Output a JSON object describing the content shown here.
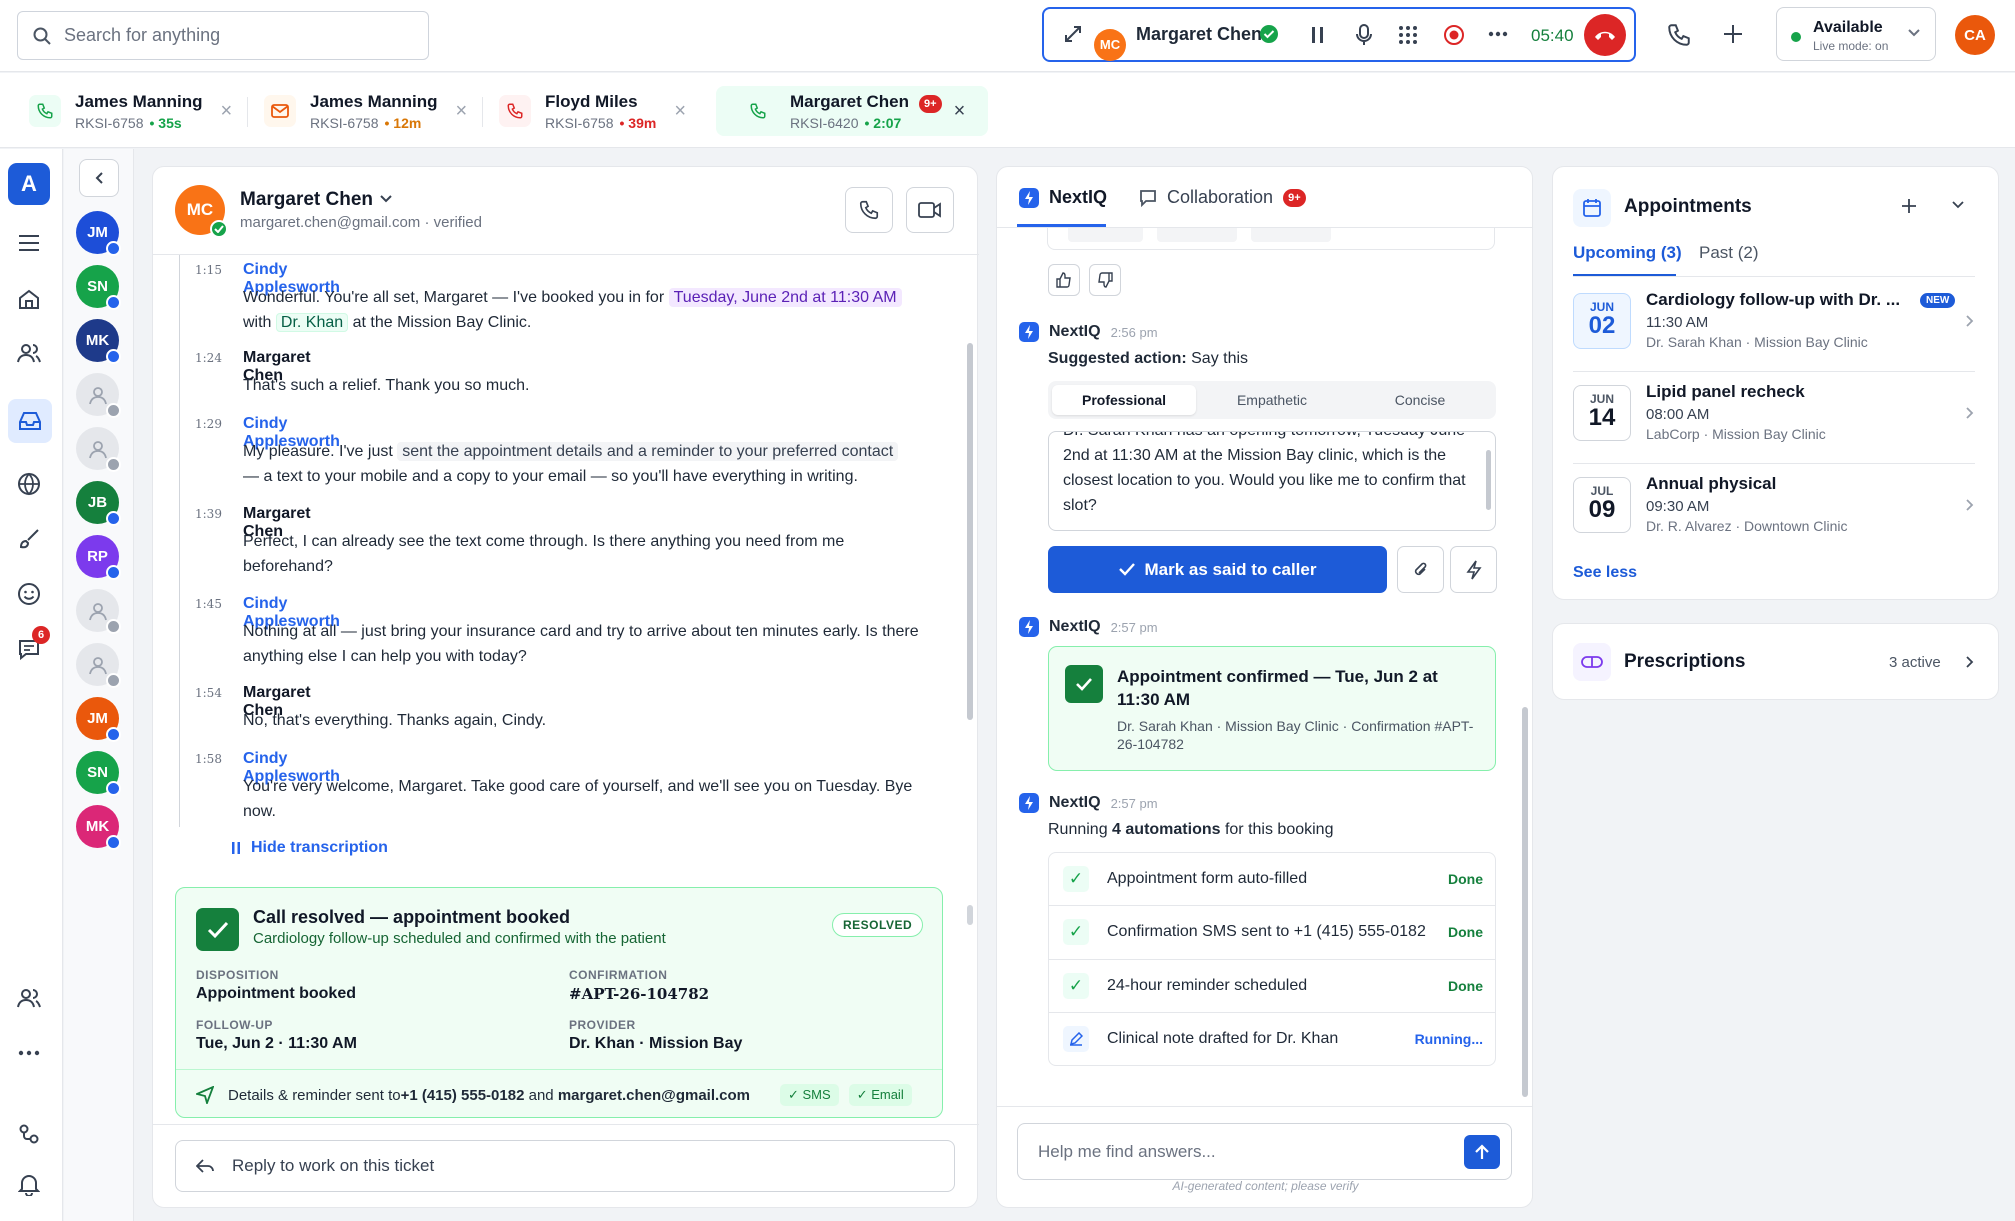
{
  "topbar": {
    "search_placeholder": "Search for anything",
    "call": {
      "initials": "MC",
      "name": "Margaret Chen",
      "timer": "05:40"
    },
    "status": {
      "label": "Available",
      "sub": "Live mode: on"
    },
    "user_initials": "CA"
  },
  "tabs": [
    {
      "name": "James Manning",
      "id": "RKSI-6758",
      "time": "35s",
      "icon": "phone-icon",
      "time_color": "#16a34a"
    },
    {
      "name": "James Manning",
      "id": "RKSI-6758",
      "time": "12m",
      "icon": "mail-icon",
      "time_color": "#d97706"
    },
    {
      "name": "Floyd Miles",
      "id": "RKSI-6758",
      "time": "39m",
      "icon": "phone-icon",
      "time_color": "#dc2626"
    },
    {
      "name": "Margaret Chen",
      "id": "RKSI-6420",
      "time": "2:07",
      "icon": "phone-icon",
      "badge": "9+",
      "time_color": "#16a34a"
    }
  ],
  "rail": {
    "logo": "A",
    "chat_badge": "6"
  },
  "queue": [
    {
      "initials": "JM",
      "color": "#1d4ed8"
    },
    {
      "initials": "SN",
      "color": "#16a34a"
    },
    {
      "initials": "MK",
      "color": "#1e3a8a"
    },
    {
      "initials": "",
      "color": ""
    },
    {
      "initials": "",
      "color": ""
    },
    {
      "initials": "JB",
      "color": "#15803d"
    },
    {
      "initials": "RP",
      "color": "#7c3aed"
    },
    {
      "initials": "",
      "color": ""
    },
    {
      "initials": "",
      "color": ""
    },
    {
      "initials": "JM",
      "color": "#ea580c"
    },
    {
      "initials": "SN",
      "color": "#16a34a"
    },
    {
      "initials": "MK",
      "color": "#db2777"
    }
  ],
  "contact": {
    "initials": "MC",
    "name": "Margaret Chen",
    "email": "margaret.chen@gmail.com · verified"
  },
  "transcript": [
    {
      "time": "1:15",
      "who": "Cindy Applesworth",
      "agent": true
    },
    {
      "time": "1:24",
      "who": "Margaret Chen",
      "text": "That's such a relief. Thank you so much."
    },
    {
      "time": "1:29",
      "who": "Cindy Applesworth",
      "agent": true
    },
    {
      "time": "1:39",
      "who": "Margaret Chen",
      "text": "Perfect, I can already see the text come through. Is there anything you need from me beforehand?"
    },
    {
      "time": "1:45",
      "who": "Cindy Applesworth",
      "agent": true,
      "text": "Nothing at all — just bring your insurance card and try to arrive about ten minutes early. Is there anything else I can help you with today?"
    },
    {
      "time": "1:54",
      "who": "Margaret Chen",
      "text": "No, that's everything. Thanks again, Cindy."
    },
    {
      "time": "1:58",
      "who": "Cindy Applesworth",
      "agent": true,
      "text": "You're very welcome, Margaret. Take good care of yourself, and we'll see you on Tuesday. Bye now."
    }
  ],
  "msg1": {
    "a": "Wonderful. You're all set, Margaret — I've booked you in for ",
    "hl": "Tuesday, June 2nd at 11:30 AM",
    "b": "with",
    "doc": "Dr. Khan",
    "c": "at the Mission Bay Clinic."
  },
  "msg3": {
    "a": "My pleasure. I've just ",
    "hl": "sent the appointment details and a reminder to your preferred contact",
    "b": "— a text to your mobile and a copy to your email — so you'll have everything in writing."
  },
  "hide_transcription": "Hide transcription",
  "resolved": {
    "title": "Call resolved — appointment booked",
    "subtitle": "Cardiology follow-up scheduled and confirmed with the patient",
    "badge": "RESOLVED",
    "disposition_label": "DISPOSITION",
    "disposition": "Appointment booked",
    "confirmation_label": "CONFIRMATION",
    "confirmation": "#APT-26-104782",
    "followup_label": "FOLLOW-UP",
    "followup": "Tue, Jun 2 · 11:30 AM",
    "provider_label": "PROVIDER",
    "provider": "Dr. Khan · Mission Bay",
    "sent_a": "Details & reminder sent to ",
    "sent_phone": "+1 (415) 555-0182",
    "sent_and": " and ",
    "sent_email": "margaret.chen@gmail.com",
    "chip_sms": "SMS",
    "chip_email": "Email"
  },
  "reply_placeholder": "Reply to work on this ticket",
  "iq": {
    "tab_nextiq": "NextIQ",
    "tab_collab": "Collaboration",
    "collab_badge": "9+",
    "block1": {
      "name": "NextIQ",
      "time": "2:56 pm",
      "suggest_label": "Suggested action:",
      "suggest_value": " Say this",
      "tones": [
        "Professional",
        "Empathetic",
        "Concise"
      ],
      "text": "Dr. Sarah Khan has an opening tomorrow, Tuesday June 2nd at 11:30 AM at the Mission Bay clinic, which is the closest location to you. Would you like me to confirm that slot?",
      "button": "Mark as said to caller"
    },
    "block2": {
      "name": "NextIQ",
      "time": "2:57 pm",
      "title": "Appointment confirmed — Tue, Jun 2 at 11:30 AM",
      "sub": "Dr. Sarah Khan · Mission Bay Clinic · Confirmation #APT-26-104782"
    },
    "block3": {
      "name": "NextIQ",
      "time": "2:57 pm",
      "intro_a": "Running ",
      "intro_b": "4 automations",
      "intro_c": " for this booking",
      "rows": [
        {
          "text": "Appointment form auto-filled",
          "status": "Done"
        },
        {
          "text": "Confirmation SMS sent to +1 (415) 555-0182",
          "status": "Done"
        },
        {
          "text": "24-hour reminder scheduled",
          "status": "Done"
        },
        {
          "text": "Clinical note drafted for Dr. Khan",
          "status": "Running..."
        }
      ]
    },
    "input_placeholder": "Help me find answers...",
    "disclaimer": "AI-generated content; please verify"
  },
  "appointments": {
    "title": "Appointments",
    "tab_upcoming": "Upcoming (3)",
    "tab_past": "Past (2)",
    "items": [
      {
        "month": "JUN",
        "day": "02",
        "title": "Cardiology follow-up with Dr. ...",
        "badge": "NEW",
        "time": "11:30 AM",
        "where": "Dr. Sarah Khan · Mission Bay Clinic"
      },
      {
        "month": "JUN",
        "day": "14",
        "title": "Lipid panel recheck",
        "time": "08:00 AM",
        "where": "LabCorp · Mission Bay Clinic"
      },
      {
        "month": "JUL",
        "day": "09",
        "title": "Annual physical",
        "time": "09:30 AM",
        "where": "Dr. R. Alvarez · Downtown Clinic"
      }
    ],
    "see_less": "See less"
  },
  "prescriptions": {
    "title": "Prescriptions",
    "count": "3 active"
  }
}
